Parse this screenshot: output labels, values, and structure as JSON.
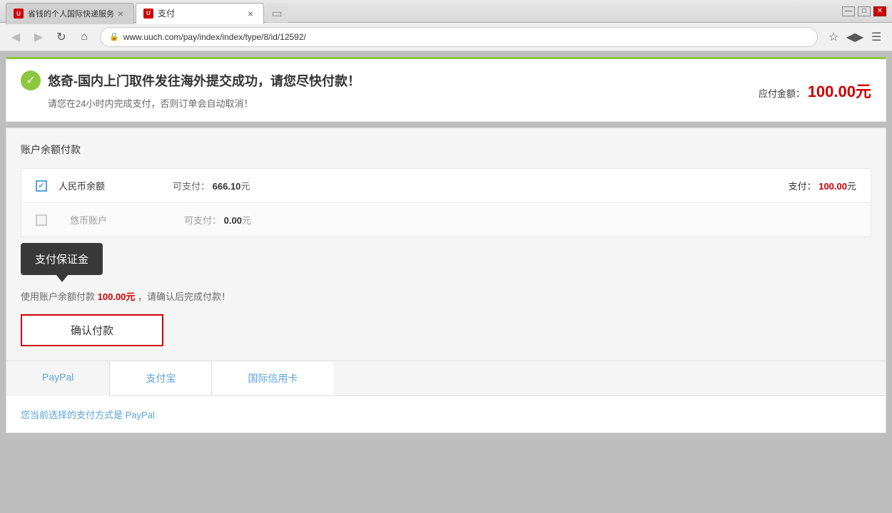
{
  "browser": {
    "tabs": [
      {
        "id": "tab1",
        "title": "省钱的个人国际快递服务",
        "icon_text": "U",
        "active": false
      },
      {
        "id": "tab2",
        "title": "支付",
        "icon_text": "U",
        "active": true
      }
    ],
    "new_tab_label": "+",
    "address": "www.uuch.com/pay/index/index/type/8/id/12592/",
    "address_full": "www.uuch.com/pay/index/index/type/8/id/12592/",
    "nav_back": "◀",
    "nav_forward": "▶",
    "nav_refresh": "↻",
    "nav_home": "⌂",
    "win_minimize": "—",
    "win_maximize": "□",
    "win_close": "✕"
  },
  "success_banner": {
    "title": "悠奇-国内上门取件发往海外提交成功，请您尽快付款！",
    "subtitle": "请您在24小时内完成支付，否则订单会自动取消！",
    "amount_label": "应付金额：",
    "amount_value": "100.00",
    "currency": "元"
  },
  "account_payment": {
    "section_title": "账户余额付款",
    "rows": [
      {
        "id": "rmb",
        "name": "人民币余额",
        "checked": true,
        "available_label": "可支付：",
        "available_amount": "666.10",
        "currency": "元",
        "pay_label": "支付：",
        "pay_amount": "100.00",
        "pay_currency": "元"
      },
      {
        "id": "youbi",
        "name": "悠币账户",
        "checked": false,
        "available_label": "可支付：",
        "available_amount": "0.00",
        "currency": "元",
        "pay_label": "",
        "pay_amount": "",
        "pay_currency": ""
      }
    ]
  },
  "tooltip": {
    "title": "支付保证金"
  },
  "confirm_section": {
    "text_prefix": "使用账户余额付款",
    "amount": "100.00",
    "currency": "元",
    "text_suffix": "，请确认后完成付款！",
    "button_label": "确认付款"
  },
  "payment_tabs": [
    {
      "id": "paypal",
      "label": "PayPal",
      "active": true
    },
    {
      "id": "alipay",
      "label": "支付宝",
      "active": false
    },
    {
      "id": "credit",
      "label": "国际信用卡",
      "active": false
    }
  ],
  "selected_payment": {
    "text_prefix": "您当前选择的支付方式是",
    "method": "PayPal"
  }
}
